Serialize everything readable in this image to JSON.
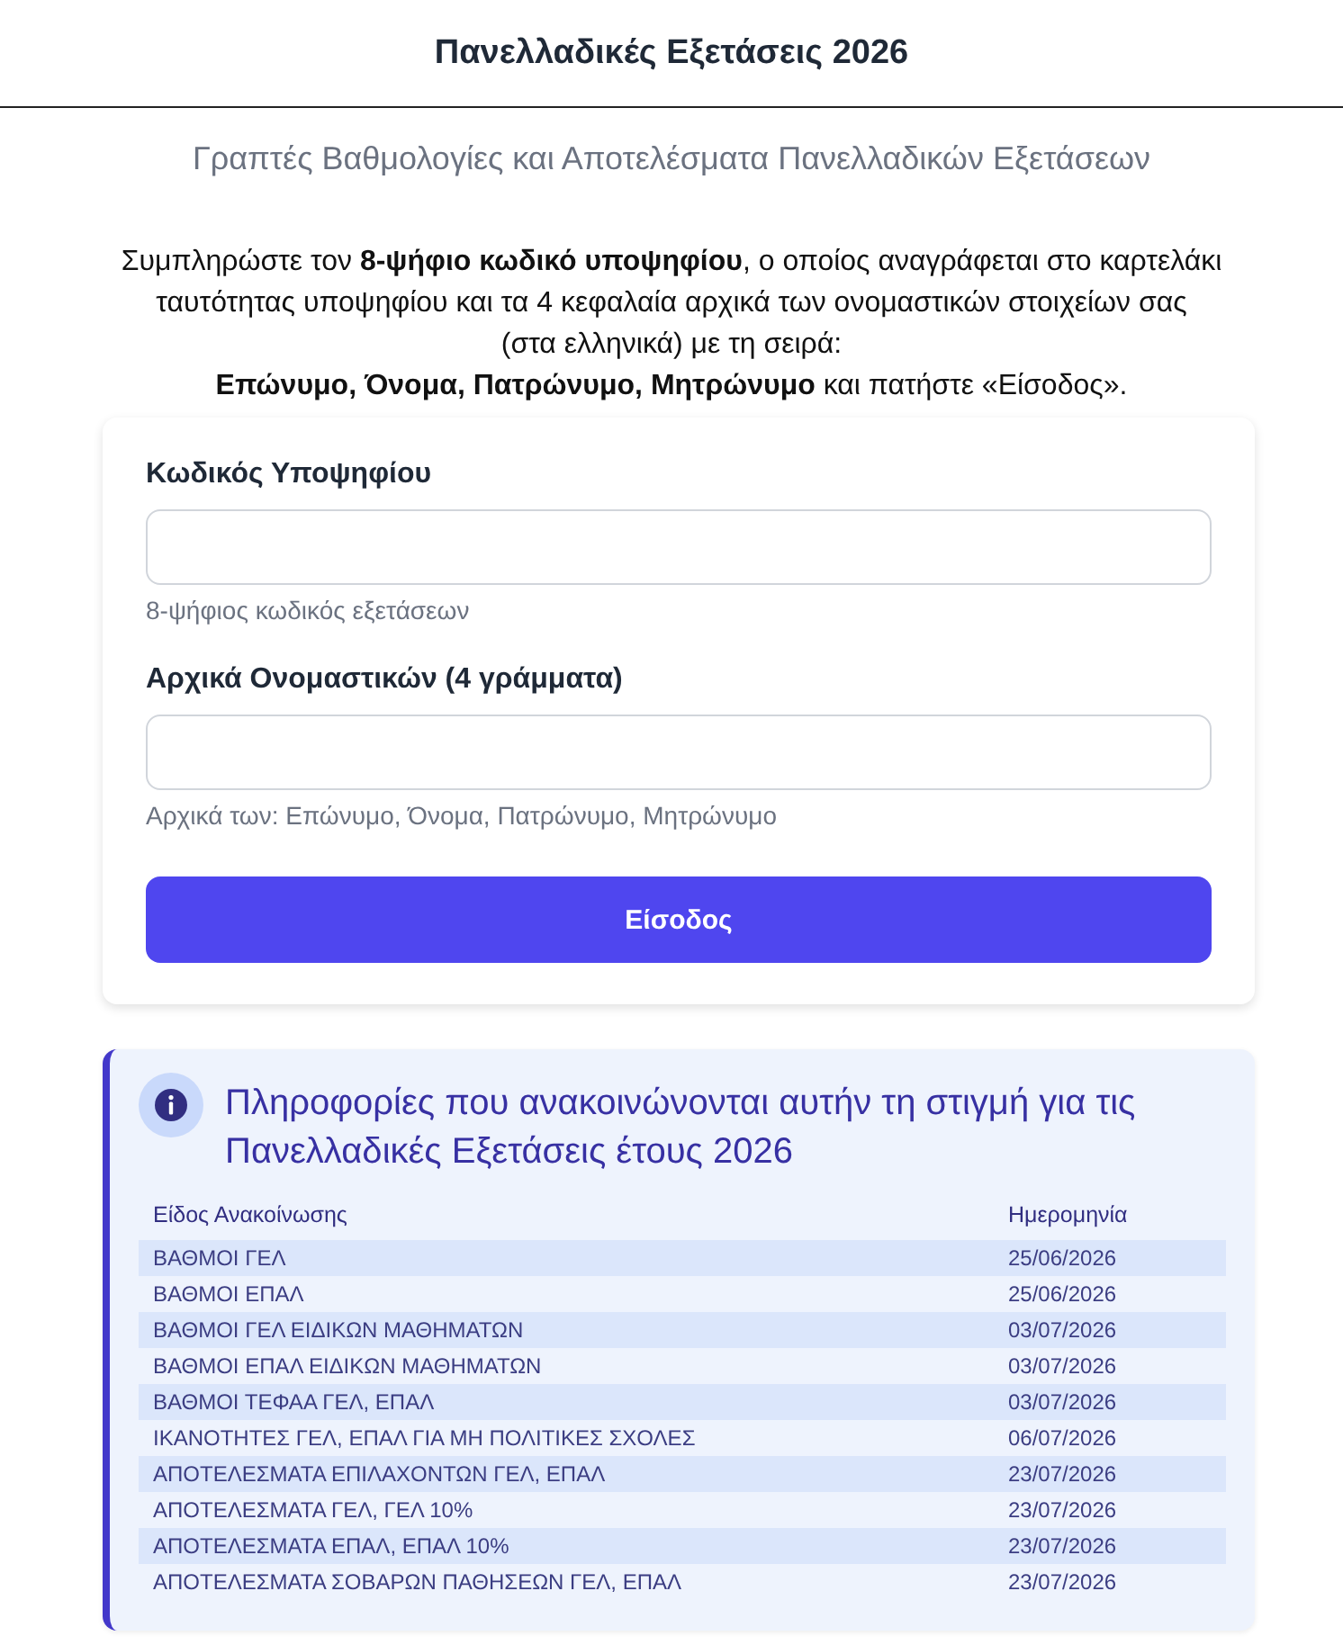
{
  "header": {
    "title": "Πανελλαδικές Εξετάσεις 2026"
  },
  "subtitle": "Γραπτές Βαθμολογίες και Αποτελέσματα Πανελλαδικών Εξετάσεων",
  "instructions": "Συμπληρώστε τον **8-ψήφιο κωδικό υποψηφίου**, ο οποίος αναγράφεται στο καρτελάκι\nταυτότητας υποψηφίου και τα 4 κεφαλαία αρχικά των ονομαστικών στοιχείων σας\n(στα ελληνικά) με τη σειρά:\n**Επώνυμο, Όνομα, Πατρώνυμο, Μητρώνυμο** και πατήστε «Είσοδος».",
  "login_form": {
    "fields": [
      {
        "label": "Κωδικός Υποψηφίου",
        "hint": "8-ψήφιος κωδικός εξετάσεων"
      },
      {
        "label": "Αρχικά Ονομαστικών (4 γράμματα)",
        "hint": "Αρχικά των: Επώνυμο, Όνομα, Πατρώνυμο, Μητρώνυμο"
      }
    ],
    "submit_button": "Είσοδος"
  },
  "info_panel": {
    "title": "Πληροφορίες που ανακοινώνονται αυτήν τη στιγμή για τις Πανελλαδικές Εξετάσεις έτους 2026",
    "table": {
      "columns": [
        "Είδος Ανακοίνωσης",
        "Ημερομηνία"
      ],
      "rows": [
        {
          "announcement": "ΒΑΘΜΟΙ ΓΕΛ",
          "date": "25/06/2026"
        },
        {
          "announcement": "ΒΑΘΜΟΙ ΕΠΑΛ",
          "date": "25/06/2026"
        },
        {
          "announcement": "ΒΑΘΜΟΙ ΓΕΛ ΕΙΔΙΚΩΝ ΜΑΘΗΜΑΤΩΝ",
          "date": "03/07/2026"
        },
        {
          "announcement": "ΒΑΘΜΟΙ ΕΠΑΛ ΕΙΔΙΚΩΝ ΜΑΘΗΜΑΤΩΝ",
          "date": "03/07/2026"
        },
        {
          "announcement": "ΒΑΘΜΟΙ ΤΕΦΑΑ ΓΕΛ, ΕΠΑΛ",
          "date": "03/07/2026"
        },
        {
          "announcement": "ΙΚΑΝΟΤΗΤΕΣ ΓΕΛ, ΕΠΑΛ ΓΙΑ ΜΗ ΠΟΛΙΤΙΚΕΣ ΣΧΟΛΕΣ",
          "date": "06/07/2026"
        },
        {
          "announcement": "ΑΠΟΤΕΛΕΣΜΑΤΑ ΕΠΙΛΑΧΟΝΤΩΝ ΓΕΛ, ΕΠΑΛ",
          "date": "23/07/2026"
        },
        {
          "announcement": "ΑΠΟΤΕΛΕΣΜΑΤΑ ΓΕΛ, ΓΕΛ 10%",
          "date": "23/07/2026"
        },
        {
          "announcement": "ΑΠΟΤΕΛΕΣΜΑΤΑ ΕΠΑΛ, ΕΠΑΛ 10%",
          "date": "23/07/2026"
        },
        {
          "announcement": "ΑΠΟΤΕΛΕΣΜΑΤΑ ΣΟΒΑΡΩΝ ΠΑΘΗΣΕΩΝ ΓΕΛ, ΕΠΑΛ",
          "date": "23/07/2026"
        }
      ]
    }
  }
}
